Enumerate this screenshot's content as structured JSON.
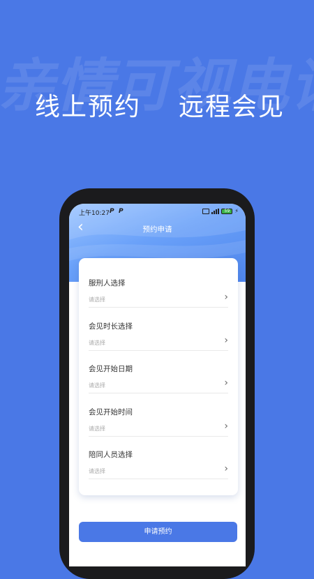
{
  "banner": {
    "watermark": "亲情可视电话",
    "tagline_left": "线上预约",
    "tagline_right": "远程会见"
  },
  "status_bar": {
    "time": "上午10:27",
    "indicators": [
      "P",
      "P"
    ],
    "battery": "59"
  },
  "navbar": {
    "back_icon": "chevron-left-icon",
    "title": "预约申请"
  },
  "form": {
    "fields": [
      {
        "label": "服刑人选择",
        "placeholder": "请选择"
      },
      {
        "label": "会见时长选择",
        "placeholder": "请选择"
      },
      {
        "label": "会见开始日期",
        "placeholder": "请选择"
      },
      {
        "label": "会见开始时间",
        "placeholder": "请选择"
      },
      {
        "label": "陪同人员选择",
        "placeholder": "请选择"
      }
    ],
    "arrow_icon": "chevron-right-icon"
  },
  "submit_label": "申请预约",
  "colors": {
    "background": "#4a78e6",
    "primary": "#4a78e6",
    "card": "#ffffff"
  }
}
